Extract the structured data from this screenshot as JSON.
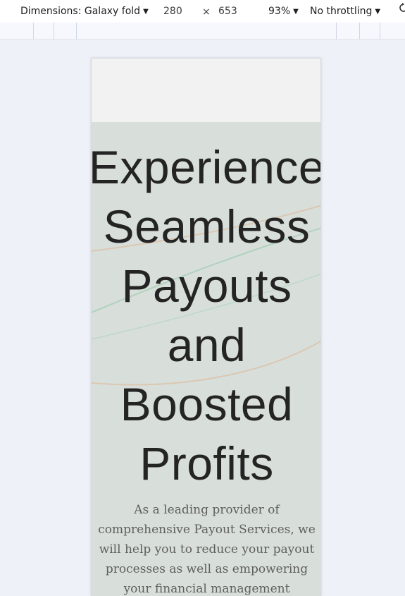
{
  "devtools": {
    "dimensions_label": "Dimensions: Galaxy fold",
    "width": "280",
    "times": "×",
    "height": "653",
    "zoom": "93%",
    "throttling": "No throttling",
    "caret_icon": "triangle-down",
    "rotate_icon": "rotate-icon"
  },
  "page": {
    "hero_title_lines": [
      "Experience",
      "Seamless",
      "Payouts",
      "and",
      "Boosted",
      "Profits"
    ],
    "hero_text": "As a leading provider of comprehensive Payout Services, we will help you to reduce your payout processes as well as empowering your financial management processes."
  },
  "colors": {
    "hero_bg": "#d8dfda",
    "wave_green": "#9bc9b0",
    "wave_tan": "#d9b89b"
  }
}
